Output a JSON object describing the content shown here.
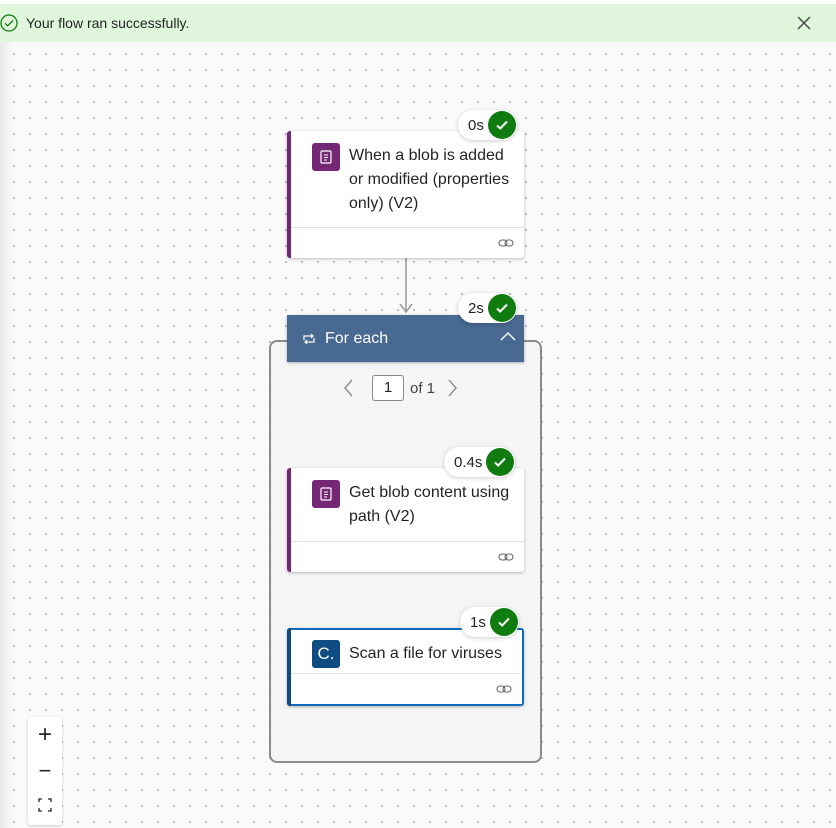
{
  "banner": {
    "message": "Your flow ran successfully.",
    "status_icon": "check-circle-icon",
    "close_icon": "close-icon",
    "bg": "#dff6dd"
  },
  "trigger": {
    "title": "When a blob is added or modified (properties only) (V2)",
    "duration": "0s",
    "status": "succeeded",
    "accent": "#742774"
  },
  "foreach": {
    "label": "For each",
    "duration": "2s",
    "page_current": "1",
    "page_total_text": "of 1",
    "header_color": "#486991"
  },
  "get_blob": {
    "title": "Get blob content using path (V2)",
    "duration": "0.4s",
    "status": "succeeded",
    "accent": "#742774"
  },
  "scan": {
    "title": "Scan a file for viruses",
    "duration": "1s",
    "status": "succeeded",
    "accent": "#0f4c81",
    "icon_letter": "C."
  },
  "zoom_controls": {
    "zoom_in": "+",
    "zoom_out": "−",
    "fit": "fit-view-icon"
  },
  "success_color": "#107c10"
}
